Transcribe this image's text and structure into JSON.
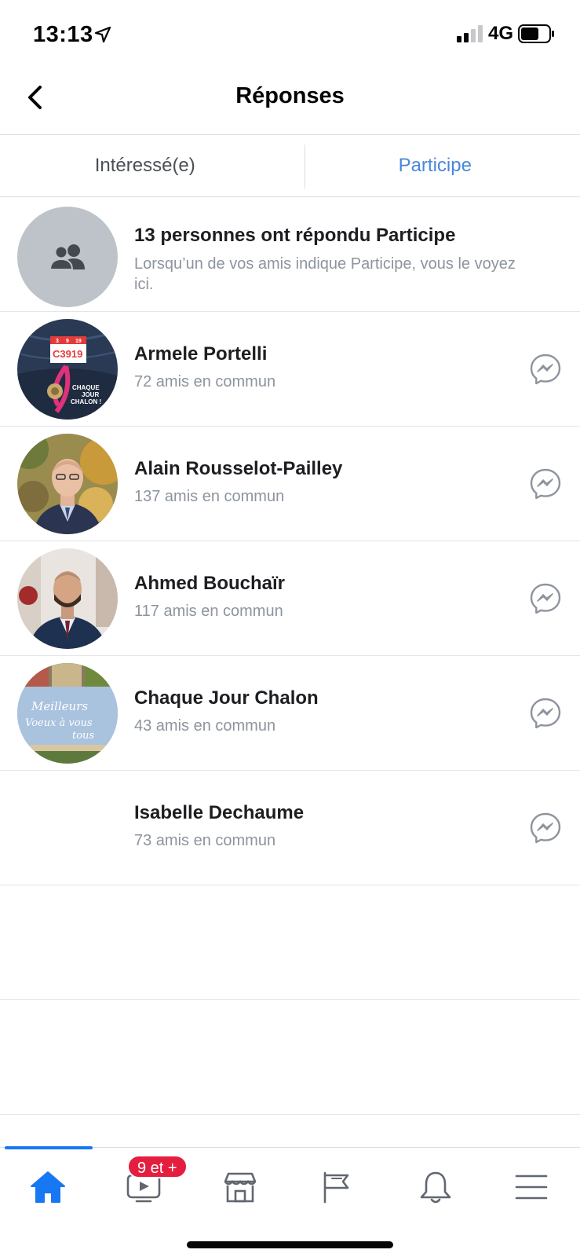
{
  "status": {
    "time": "13:13",
    "network": "4G"
  },
  "nav": {
    "title": "Réponses"
  },
  "tabs": [
    {
      "label": "Intéressé(e)",
      "active": false
    },
    {
      "label": "Participe",
      "active": true
    }
  ],
  "summary": {
    "title": "13 personnes ont répondu Participe",
    "subtitle": "Lorsqu’un de vos amis indique Participe, vous le voyez ici."
  },
  "people": [
    {
      "name": "Armele Portelli",
      "mutual": "72 amis en commun"
    },
    {
      "name": "Alain Rousselot-Pailley",
      "mutual": "137 amis en commun"
    },
    {
      "name": "Ahmed Bouchaïr",
      "mutual": "117 amis en commun"
    },
    {
      "name": "Chaque Jour Chalon",
      "mutual": "43 amis en commun"
    },
    {
      "name": "Isabelle Dechaume",
      "mutual": "73 amis en commun"
    }
  ],
  "avatar_texts": {
    "armele_badge": "C3919",
    "armele_badge_digits": [
      "3",
      "9",
      "19"
    ],
    "armele_ribbon": [
      "CHAQUE",
      "JOUR",
      "CHALON !"
    ],
    "chalon_script": [
      "Meilleurs",
      "Voeux à vous",
      "tous"
    ]
  },
  "tabbar": {
    "items": [
      "home-icon",
      "watch-icon",
      "marketplace-icon",
      "pages-flag-icon",
      "notifications-bell-icon",
      "menu-icon"
    ],
    "active": "home-icon",
    "badge": "9 et +"
  },
  "colors": {
    "accent": "#1877f2",
    "active_tab_text": "#4a87d9",
    "badge": "#e41e3f"
  }
}
